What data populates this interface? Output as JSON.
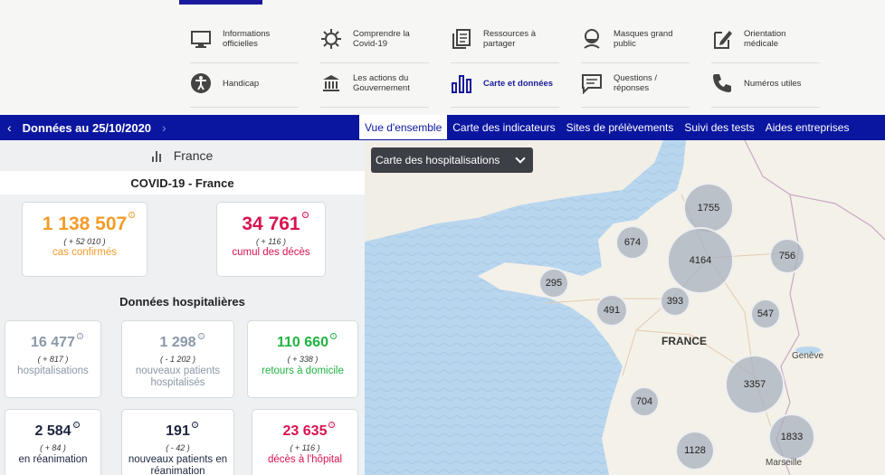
{
  "nav": {
    "items": [
      {
        "label": "Informations officielles",
        "icon": "monitor-icon"
      },
      {
        "label": "Comprendre la Covid-19",
        "icon": "virus-icon"
      },
      {
        "label": "Ressources à partager",
        "icon": "documents-icon"
      },
      {
        "label": "Masques grand public",
        "icon": "mask-icon"
      },
      {
        "label": "Orientation médicale",
        "icon": "clipboard-edit-icon"
      },
      {
        "label": "Handicap",
        "icon": "accessibility-icon"
      },
      {
        "label": "Les actions du Gouvernement",
        "icon": "government-building-icon"
      },
      {
        "label": "Carte et données",
        "icon": "bar-chart-icon",
        "active": true
      },
      {
        "label": "Questions / réponses",
        "icon": "chat-bubble-icon"
      },
      {
        "label": "Numéros utiles",
        "icon": "phone-icon"
      }
    ]
  },
  "datebar": {
    "prev": "‹",
    "next": "›",
    "date": "Données au 25/10/2020"
  },
  "tabs": [
    {
      "label": "Vue d'ensemble",
      "active": true
    },
    {
      "label": "Carte des indicateurs"
    },
    {
      "label": "Sites de prélèvements"
    },
    {
      "label": "Suivi des tests"
    },
    {
      "label": "Aides entreprises"
    }
  ],
  "left": {
    "region": "France",
    "covid_title": "COVID-19 - France",
    "summary": {
      "cases": {
        "value": "1 138 507",
        "delta": "( + 52 010 )",
        "label": "cas confirmés"
      },
      "deaths": {
        "value": "34 761",
        "delta": "( + 116 )",
        "label": "cumul des décès"
      }
    },
    "hosp_title": "Données hospitalières",
    "hosp_cards": [
      {
        "value": "16 477",
        "delta": "( + 817 )",
        "label": "hospitalisations"
      },
      {
        "value": "1 298",
        "delta": "( - 1 202 )",
        "label": "nouveaux patients hospitalisés"
      },
      {
        "value": "110 660",
        "delta": "( + 338 )",
        "label": "retours à domicile"
      },
      {
        "value": "2 584",
        "delta": "( + 84 )",
        "label": "en réanimation"
      },
      {
        "value": "191",
        "delta": "( - 42 )",
        "label": "nouveaux patients en réanimation"
      },
      {
        "value": "23 635",
        "delta": "( + 116 )",
        "label": "décès à l'hôpital"
      }
    ]
  },
  "map": {
    "select_label": "Carte des hospitalisations",
    "country_label": "FRANCE",
    "city_geneve": "Genève",
    "city_marseille": "Marseille",
    "bubbles": [
      "1755",
      "674",
      "4164",
      "756",
      "295",
      "393",
      "491",
      "547",
      "704",
      "3357",
      "1128",
      "1833"
    ]
  },
  "colors": {
    "brand_blue": "#0b16a0",
    "cases": "#f39b29",
    "deaths": "#d8134f",
    "returns": "#20b342",
    "muted": "#8a97a6"
  }
}
